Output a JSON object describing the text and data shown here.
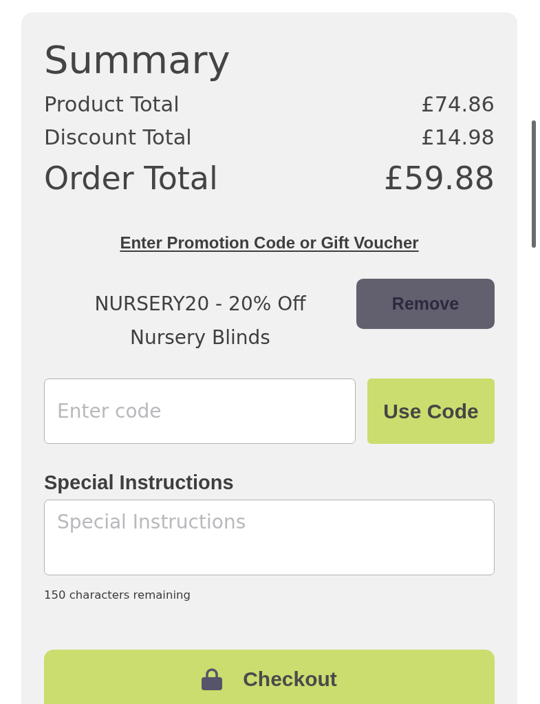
{
  "summary": {
    "title": "Summary",
    "lines": [
      {
        "kind": "subtotal",
        "label": "Product Total",
        "amount": "£74.86"
      },
      {
        "kind": "subtotal",
        "label": "Discount Total",
        "amount": "£14.98"
      },
      {
        "kind": "total",
        "label": "Order Total",
        "amount": "£59.88"
      }
    ]
  },
  "promotion": {
    "link": "Enter Promotion Code or Gift Voucher",
    "applied": {
      "description": "NURSERY20 - 20% Off Nursery Blinds",
      "remove_button": "Remove"
    },
    "code_field": {
      "placeholder": "Enter code"
    },
    "apply_button": "Use Code"
  },
  "special_instructions": {
    "label": "Special Instructions",
    "field": {
      "placeholder": "Special Instructions"
    },
    "counter": "150 characters remaining"
  },
  "checkout_button": {
    "label": "Checkout"
  }
}
